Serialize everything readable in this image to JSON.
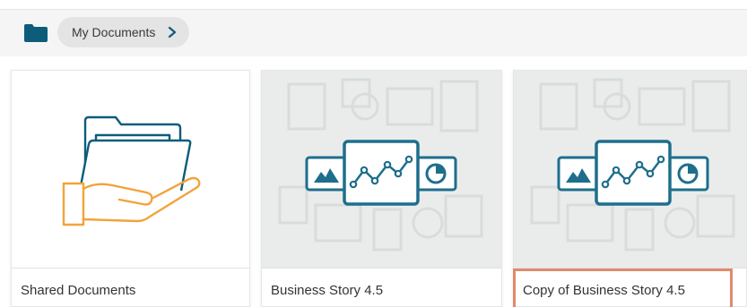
{
  "breadcrumb": {
    "root_icon": "folder-icon",
    "items": [
      {
        "label": "My Documents",
        "icon": "chevron-right-icon"
      }
    ]
  },
  "colors": {
    "folder_blue": "#0d5c7a",
    "accent_orange": "#f2a33a",
    "story_teal": "#1e6e8c",
    "selection_border": "#e08a6b"
  },
  "cards": [
    {
      "label": "Shared Documents",
      "thumbnail": "shared-folder-hand-icon"
    },
    {
      "label": "Business Story 4.5",
      "thumbnail": "business-story-icon"
    },
    {
      "label": "Copy of Business Story 4.5",
      "thumbnail": "business-story-icon",
      "selected": true
    }
  ]
}
